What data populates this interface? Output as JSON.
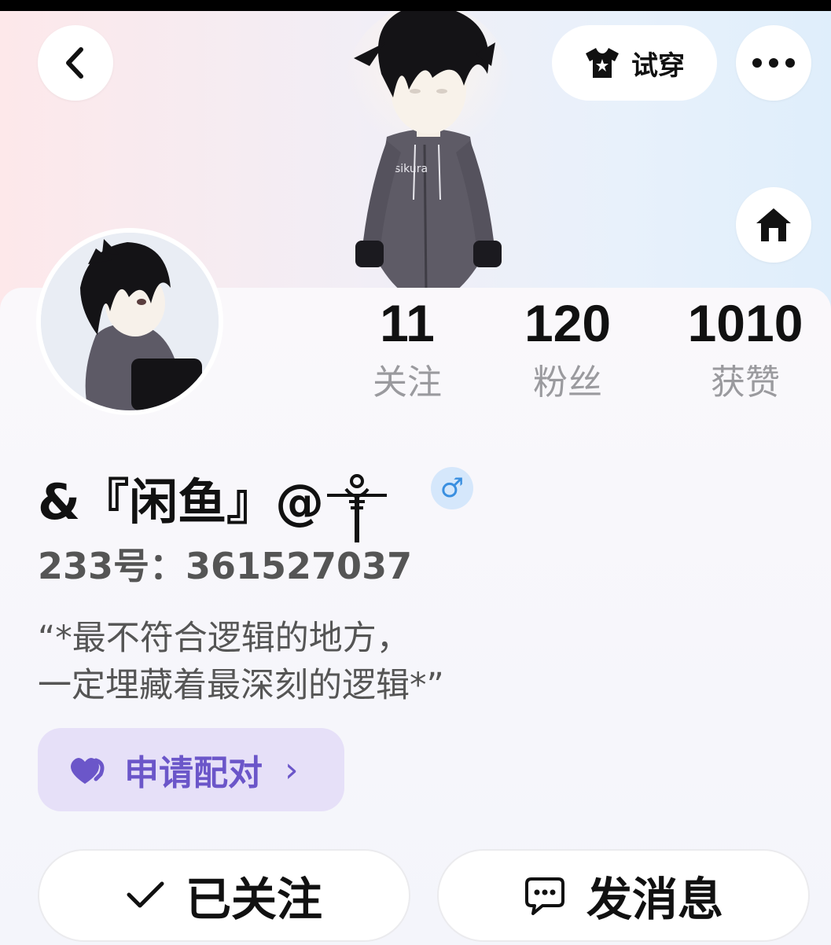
{
  "header": {
    "back_icon": "chevron-left-icon",
    "try_on_label": "试穿",
    "try_on_icon": "tshirt-icon",
    "more_icon": "more-dots-icon",
    "home_icon": "home-icon"
  },
  "stats": [
    {
      "value": "11",
      "label": "关注"
    },
    {
      "value": "120",
      "label": "粉丝"
    },
    {
      "value": "1010",
      "label": "获赞"
    }
  ],
  "profile": {
    "nickname": "&『闲鱼』@",
    "gender_symbol": "♂",
    "uid": "233号：361527037",
    "bio_line1": "“*最不符合逻辑的地方，",
    "bio_line2": "一定埋藏着最深刻的逻辑*”",
    "hoodie_text": "sikura"
  },
  "match": {
    "label": "申请配对",
    "arrow": "›"
  },
  "actions": {
    "follow_label": "已关注",
    "message_label": "发消息"
  },
  "colors": {
    "accent_purple": "#6b56c9",
    "match_bg": "#e6e0f8",
    "gender_blue": "#3a8fe0"
  }
}
